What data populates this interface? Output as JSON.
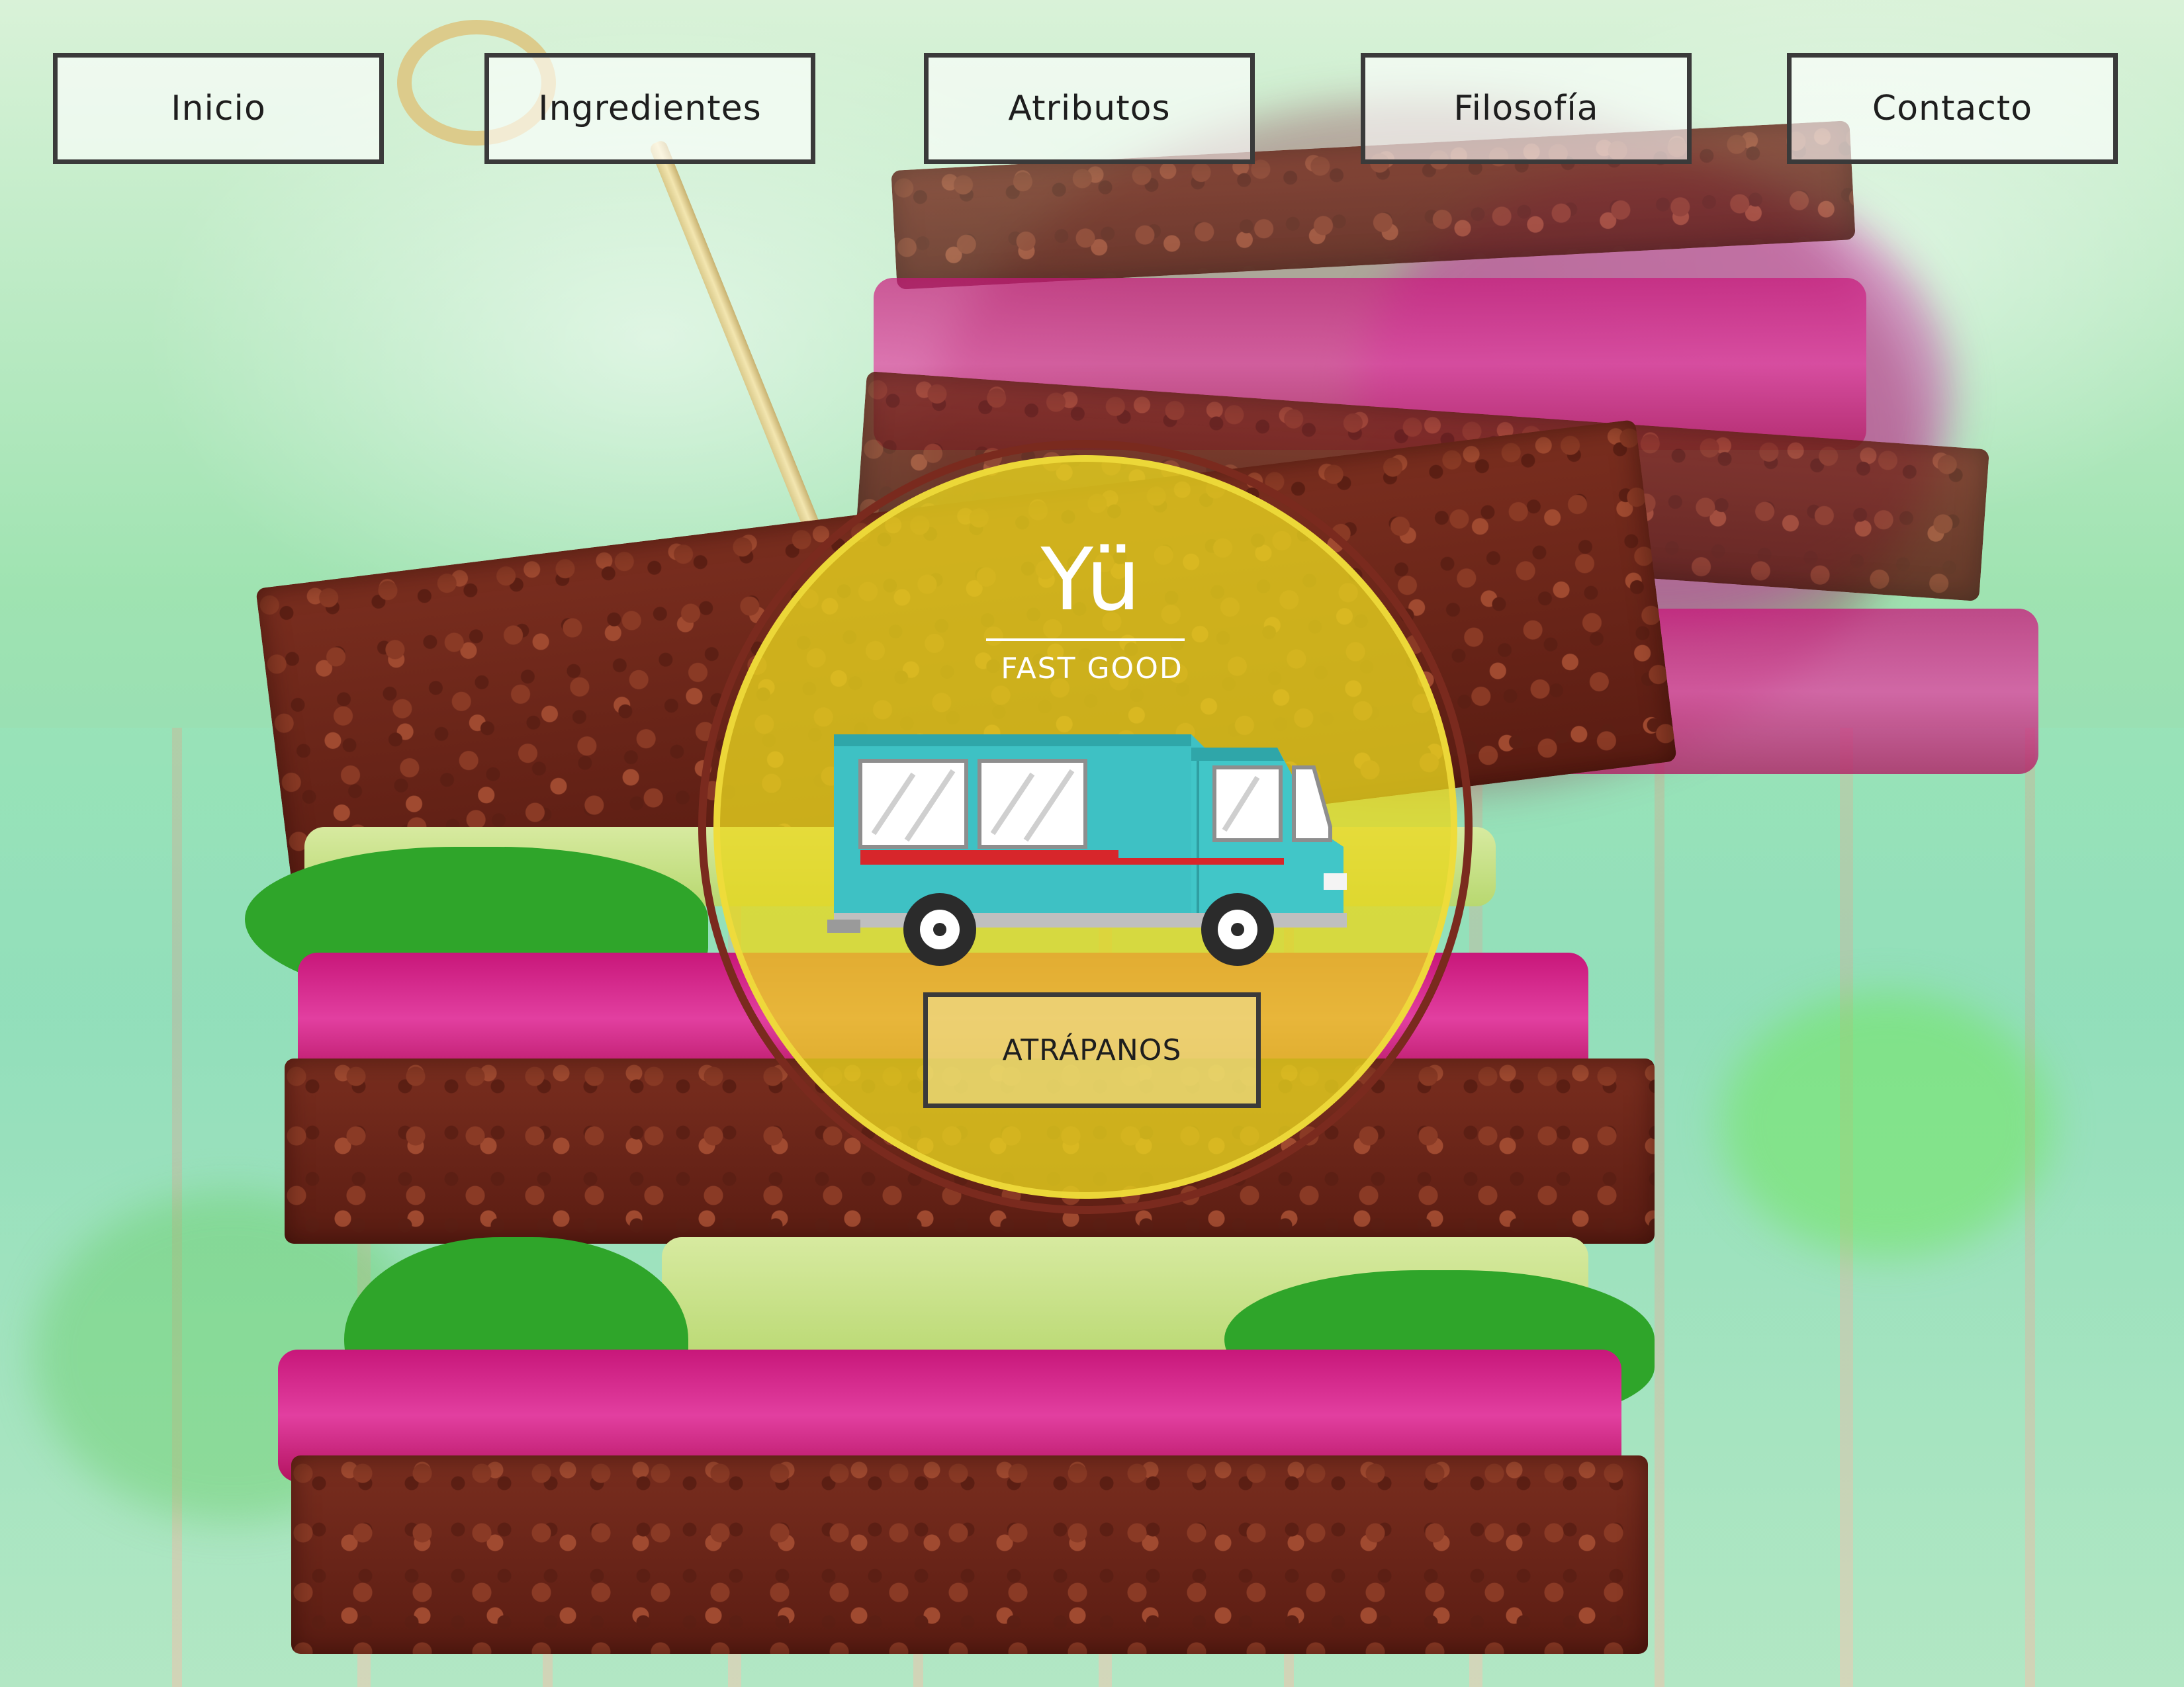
{
  "nav": {
    "items": [
      {
        "label": "Inicio"
      },
      {
        "label": "Ingredientes"
      },
      {
        "label": "Atributos"
      },
      {
        "label": "Filosofía"
      },
      {
        "label": "Contacto"
      }
    ]
  },
  "hero": {
    "brand_name": "Yü",
    "tagline": "FAST GOOD",
    "cta_label": "ATRÁPANOS",
    "badge_color": "#e9d71e",
    "truck_icon": "food-truck-icon",
    "truck_color": "#3ec1c4"
  },
  "background": {
    "image": "sandwich-photo"
  }
}
